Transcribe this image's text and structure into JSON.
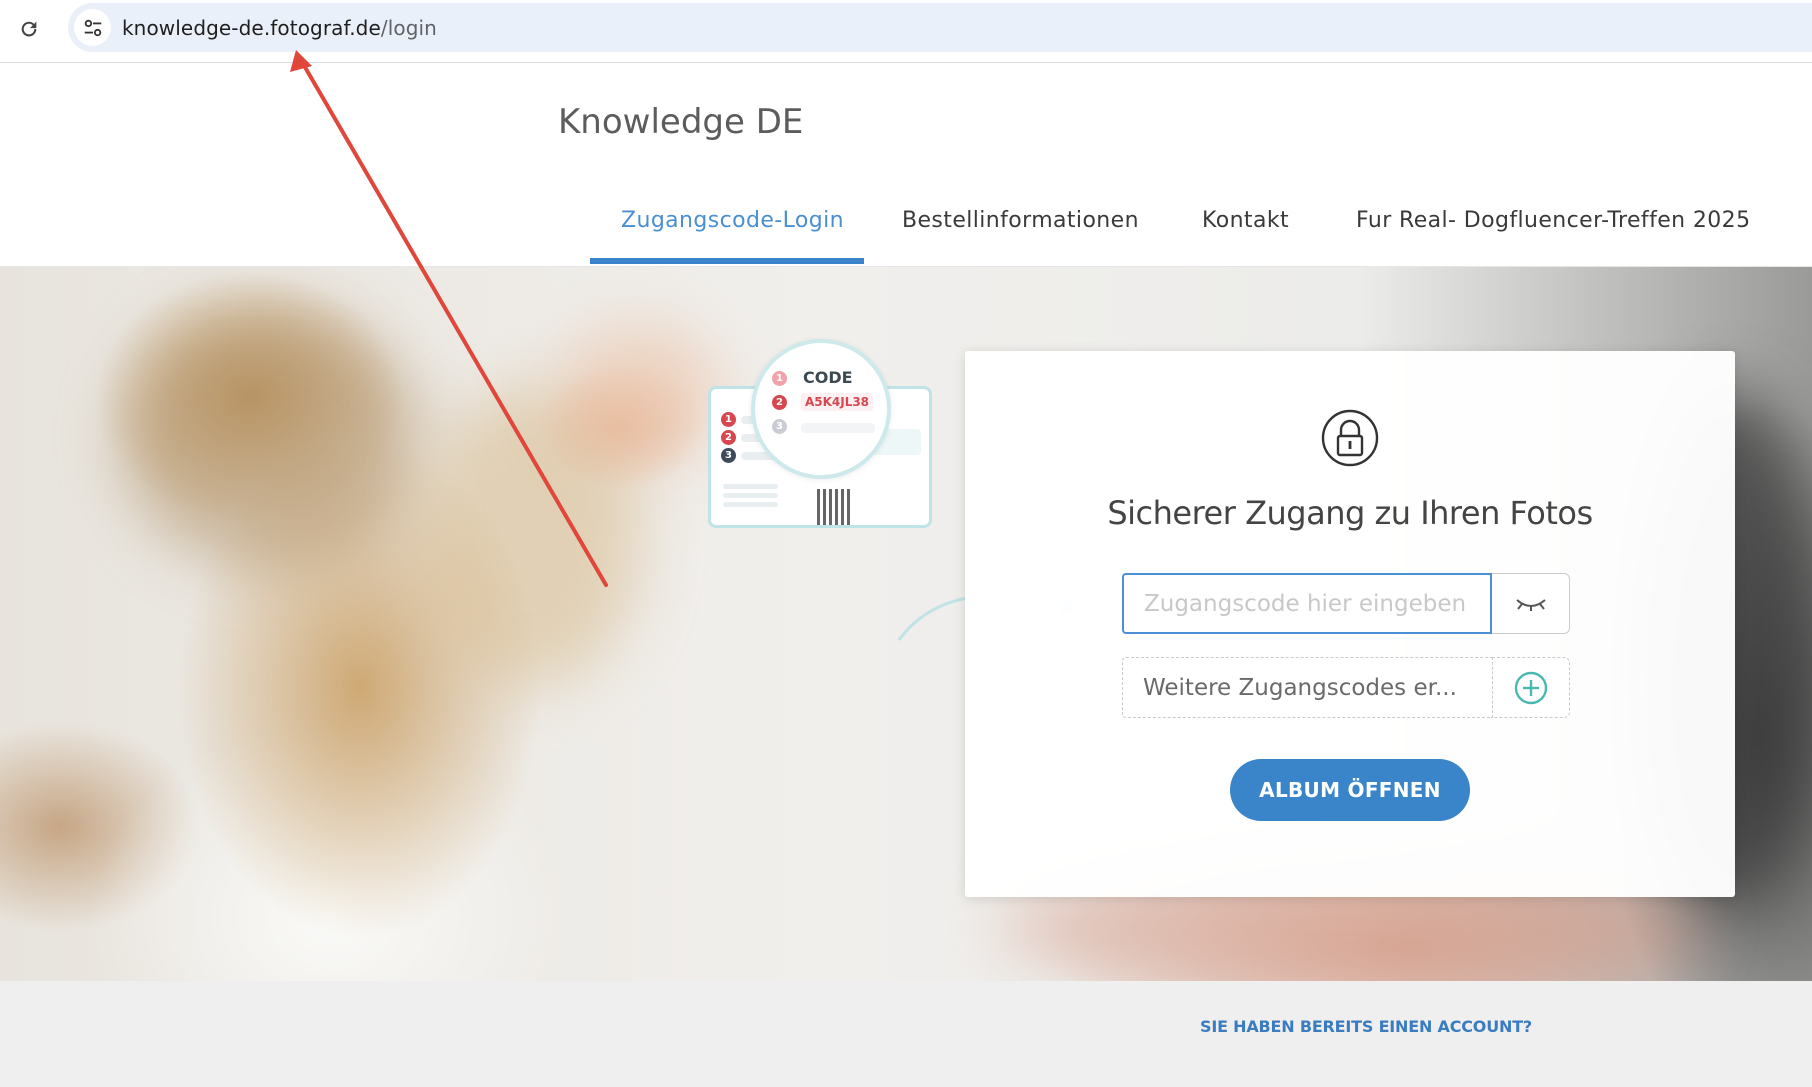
{
  "browser": {
    "url_host": "knowledge-de.fotograf.de",
    "url_path": "/login"
  },
  "site": {
    "title": "Knowledge DE"
  },
  "nav": {
    "items": [
      {
        "label": "Zugangscode-Login",
        "active": true
      },
      {
        "label": "Bestellinformationen",
        "active": false
      },
      {
        "label": "Kontakt",
        "active": false
      },
      {
        "label": "Fur Real- Dogfluencer-Treffen 2025",
        "active": false
      }
    ]
  },
  "illustration": {
    "code_label": "CODE",
    "code_value": "A5K4JL38",
    "step_numbers": [
      "1",
      "2",
      "3"
    ]
  },
  "login": {
    "heading": "Sicherer Zugang zu Ihren Fotos",
    "code_placeholder": "Zugangscode hier eingeben",
    "code_value": "",
    "more_placeholder": "Weitere Zugangscodes er...",
    "open_button": "ALBUM ÖFFNEN"
  },
  "footer": {
    "account_link": "SIE HABEN BEREITS EINEN ACCOUNT?"
  },
  "colors": {
    "accent": "#3a85c9",
    "nav_active": "#4a8fd1",
    "annotation_arrow": "#e0463a",
    "code_red": "#d6474f",
    "plus_icon": "#4bb8b0"
  },
  "icons": {
    "reload": "reload-icon",
    "site_info": "tune-icon",
    "lock": "lock-icon",
    "visibility": "eye-closed-icon",
    "add": "plus-circle-icon"
  }
}
